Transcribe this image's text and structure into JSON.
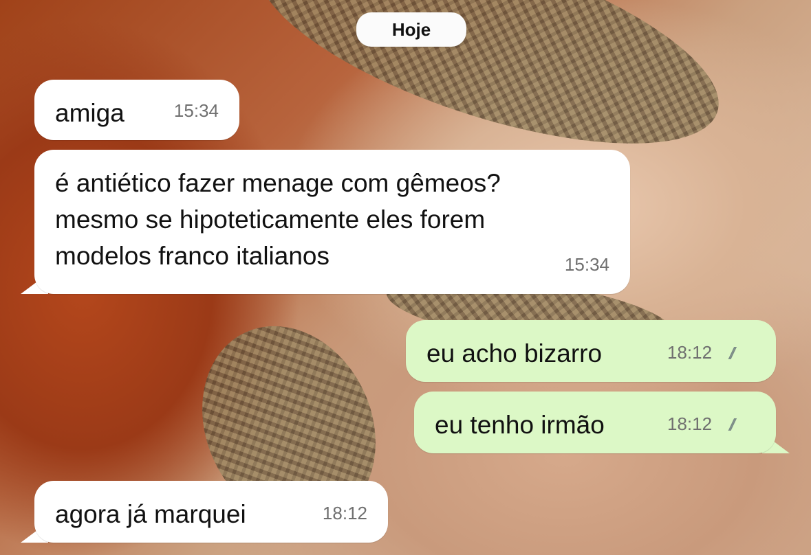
{
  "chat": {
    "date_label": "Hoje",
    "messages": [
      {
        "direction": "incoming",
        "text": "amiga",
        "time": "15:34"
      },
      {
        "direction": "incoming",
        "text": "é antiético fazer menage com gêmeos?\nmesmo se hipoteticamente eles forem\nmodelos franco italianos",
        "time": "15:34"
      },
      {
        "direction": "outgoing",
        "text": "eu acho bizarro",
        "time": "18:12",
        "status": "read",
        "status_icon": "double-check-icon"
      },
      {
        "direction": "outgoing",
        "text": "eu tenho irmão",
        "time": "18:12",
        "status": "read",
        "status_icon": "double-check-icon"
      },
      {
        "direction": "incoming",
        "text": "agora já marquei",
        "time": "18:12"
      }
    ]
  },
  "colors": {
    "incoming_bubble": "#ffffff",
    "outgoing_bubble": "#dcf8c6",
    "time_text": "#6f6f6f"
  }
}
